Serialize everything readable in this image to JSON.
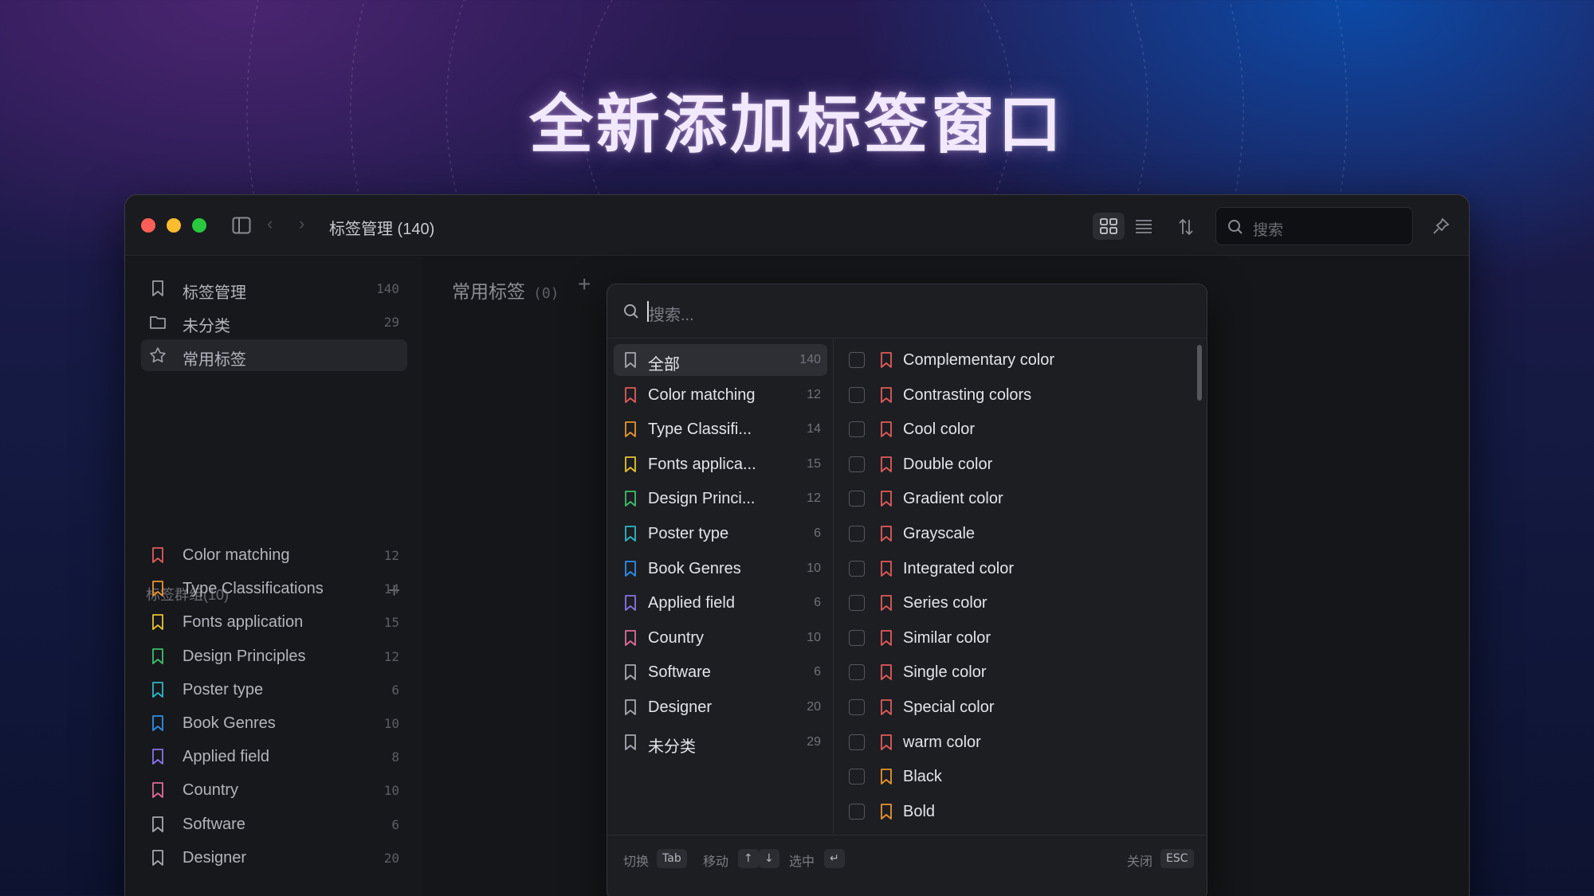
{
  "headline": "全新添加标签窗口",
  "window": {
    "title": "标签管理 (140)",
    "search_placeholder": "搜索",
    "colors": {
      "close": "#ff5f57",
      "minimize": "#febc2e",
      "zoom": "#28c840"
    }
  },
  "sidebar": {
    "nav": [
      {
        "label": "标签管理",
        "count": "140",
        "icon": "bookmark-icon"
      },
      {
        "label": "未分类",
        "count": "29",
        "icon": "folder-icon"
      },
      {
        "label": "常用标签",
        "count": "",
        "icon": "star-icon",
        "active": true
      }
    ],
    "group_title": "标签群组(10)",
    "groups": [
      {
        "label": "Color matching",
        "count": "12",
        "color": "#e05a5a"
      },
      {
        "label": "Type Classifications",
        "count": "14",
        "color": "#e8942e"
      },
      {
        "label": "Fonts application",
        "count": "15",
        "color": "#e8c22e"
      },
      {
        "label": "Design Principles",
        "count": "12",
        "color": "#3fbf6a"
      },
      {
        "label": "Poster type",
        "count": "6",
        "color": "#2fb7c9"
      },
      {
        "label": "Book Genres",
        "count": "10",
        "color": "#2f8ee8"
      },
      {
        "label": "Applied field",
        "count": "8",
        "color": "#8a72e8"
      },
      {
        "label": "Country",
        "count": "10",
        "color": "#e06a9a"
      },
      {
        "label": "Software",
        "count": "6",
        "color": "#a6a7ae"
      },
      {
        "label": "Designer",
        "count": "20",
        "color": "#a6a7ae"
      }
    ]
  },
  "main": {
    "heading": "常用标签",
    "count": "(0)"
  },
  "popup": {
    "search_placeholder": "搜索...",
    "categories": [
      {
        "label": "全部",
        "count": "140",
        "color": "#a6a7ae",
        "active": true
      },
      {
        "label": "Color matching",
        "count": "12",
        "color": "#e05a5a"
      },
      {
        "label": "Type Classifi...",
        "count": "14",
        "color": "#e8942e"
      },
      {
        "label": "Fonts applica...",
        "count": "15",
        "color": "#e8c22e"
      },
      {
        "label": "Design Princi...",
        "count": "12",
        "color": "#3fbf6a"
      },
      {
        "label": "Poster type",
        "count": "6",
        "color": "#2fb7c9"
      },
      {
        "label": "Book Genres",
        "count": "10",
        "color": "#2f8ee8"
      },
      {
        "label": "Applied field",
        "count": "6",
        "color": "#8a72e8"
      },
      {
        "label": "Country",
        "count": "10",
        "color": "#e06a9a"
      },
      {
        "label": "Software",
        "count": "6",
        "color": "#a6a7ae"
      },
      {
        "label": "Designer",
        "count": "20",
        "color": "#a6a7ae"
      },
      {
        "label": "未分类",
        "count": "29",
        "color": "#a6a7ae"
      }
    ],
    "tags": [
      {
        "label": "Complementary color",
        "color": "#e05a5a"
      },
      {
        "label": "Contrasting colors",
        "color": "#e05a5a"
      },
      {
        "label": "Cool color",
        "color": "#e05a5a"
      },
      {
        "label": "Double color",
        "color": "#e05a5a"
      },
      {
        "label": "Gradient color",
        "color": "#e05a5a"
      },
      {
        "label": "Grayscale",
        "color": "#e05a5a"
      },
      {
        "label": "Integrated color",
        "color": "#e05a5a"
      },
      {
        "label": "Series color",
        "color": "#e05a5a"
      },
      {
        "label": "Similar color",
        "color": "#e05a5a"
      },
      {
        "label": "Single color",
        "color": "#e05a5a"
      },
      {
        "label": "Special color",
        "color": "#e05a5a"
      },
      {
        "label": "warm color",
        "color": "#e05a5a"
      },
      {
        "label": "Black",
        "color": "#e8942e"
      },
      {
        "label": "Bold",
        "color": "#e8942e"
      }
    ],
    "footer": {
      "switch": "切换",
      "switch_key": "Tab",
      "move": "移动",
      "move_up": "↑",
      "move_down": "↓",
      "select": "选中",
      "select_key": "↵",
      "close": "关闭",
      "close_key": "ESC"
    }
  }
}
